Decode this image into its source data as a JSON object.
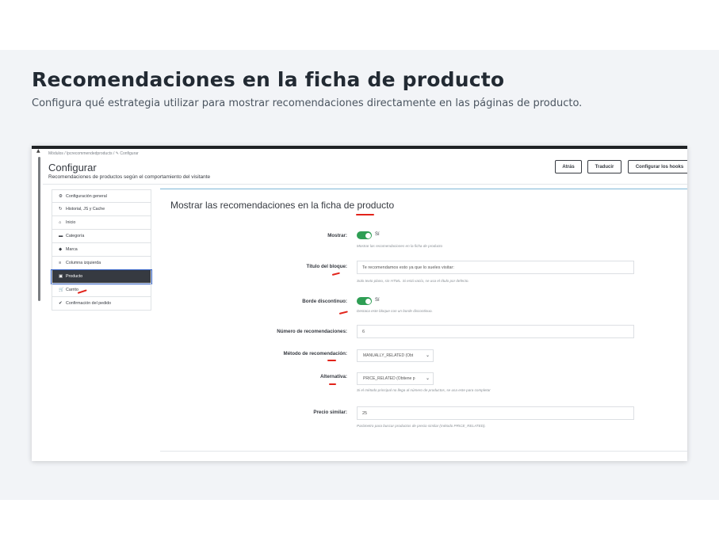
{
  "hero": {
    "title": "Recomendaciones en la ficha de producto",
    "subtitle": "Configura qué estrategia utilizar para mostrar recomendaciones directamente en las páginas de producto."
  },
  "header": {
    "breadcrumb": "Módulos  /  lpcrecommendedproducts  /  ✎ Configurar",
    "title": "Configurar",
    "subtitle": "Recomendaciones de productos según el comportamiento del visitante",
    "buttons": {
      "back": "Atrás",
      "translate": "Traducir",
      "hooks": "Configurar los hooks"
    }
  },
  "sidebar": {
    "items": [
      {
        "icon": "⚙",
        "label": "Configuración general"
      },
      {
        "icon": "↻",
        "label": "Historial, JS y Cache"
      },
      {
        "icon": "⌂",
        "label": "Inicio"
      },
      {
        "icon": "▬",
        "label": "Categoría"
      },
      {
        "icon": "◆",
        "label": "Marca"
      },
      {
        "icon": "≡",
        "label": "Columna izquierda"
      },
      {
        "icon": "▣",
        "label": "Producto"
      },
      {
        "icon": "🛒",
        "label": "Carrito"
      },
      {
        "icon": "✔",
        "label": "Confirmación del pedido"
      }
    ],
    "active_index": 6
  },
  "panel": {
    "title": "Mostrar las recomendaciones en la ficha de producto",
    "fields": {
      "show": {
        "label": "Mostrar:",
        "value": "Sí",
        "help": "Mostrar las recomendaciones en la ficha de producto"
      },
      "block_title": {
        "label": "Título del bloque:",
        "value": "Te recomendamos esto ya que lo sueles visitar:",
        "help": "Solo texto plano, sin HTML. Si está vacío, se usa el título por defecto."
      },
      "border": {
        "label": "Borde discontinuo:",
        "value": "Sí",
        "help": "Destaca este bloque con un borde discontinuo."
      },
      "count": {
        "label": "Número de recomendaciones:",
        "value": "6"
      },
      "method": {
        "label": "Método de recomendación:",
        "value": "MANUALLY_RELATED (Obt"
      },
      "fallback": {
        "label": "Alternativa:",
        "value": "PRICE_RELATED (Obtiene p",
        "help": "Si el método principal no llega al número de productos, se usa este para completar"
      },
      "similar_price": {
        "label": "Precio similar:",
        "value": "25",
        "help": "Parámetro para buscar productos de precio similar (método PRICE_RELATED)."
      }
    }
  },
  "colors": {
    "toggle_on": "#2e9e54",
    "active_item": "#363a41",
    "annotation": "#e2231a",
    "panel_border": "#7fb8d8"
  }
}
